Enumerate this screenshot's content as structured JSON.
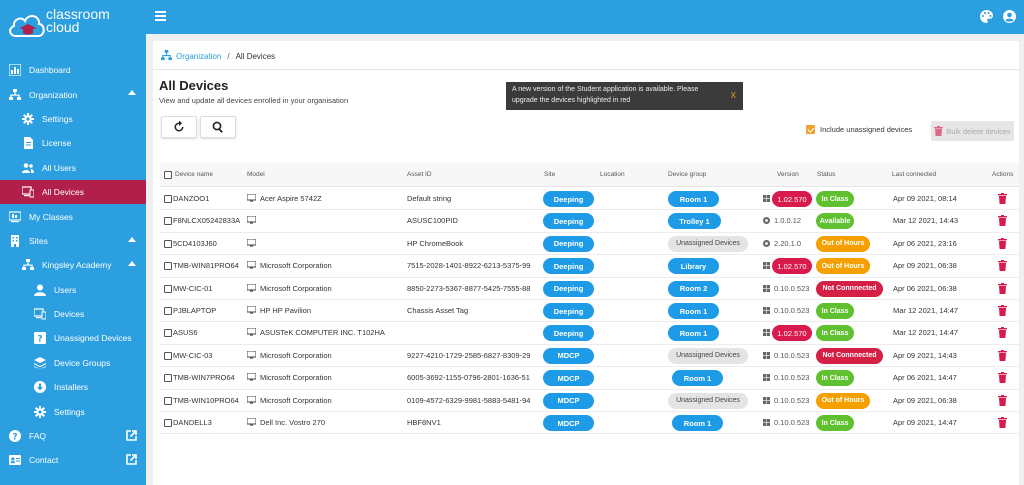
{
  "app": {
    "logo_line1": "classroom",
    "logo_line2": "cloud"
  },
  "nav": {
    "dashboard": "Dashboard",
    "organization": "Organization",
    "settings": "Settings",
    "license": "License",
    "all_users": "All Users",
    "all_devices": "All Devices",
    "my_classes": "My Classes",
    "sites": "Sites",
    "kingsley": "Kingsley Academy",
    "users": "Users",
    "devices": "Devices",
    "unassigned_devices": "Unassigned Devices",
    "device_groups": "Device Groups",
    "installers": "Installers",
    "site_settings": "Settings",
    "faq": "FAQ",
    "contact": "Contact"
  },
  "breadcrumb": {
    "root": "Organization",
    "sep": "/",
    "current": "All Devices"
  },
  "page": {
    "title": "All Devices",
    "subtitle": "View and update all devices enrolled in your organisation"
  },
  "toast": {
    "message": "A new version of the Student application is available. Please upgrade the devices highlighted in red",
    "close": "X"
  },
  "toolbar": {
    "include_unassigned": "Include unassigned devices",
    "bulk_delete": "Bulk delete devices"
  },
  "table": {
    "headers": {
      "device_name": "Device name",
      "model": "Model",
      "asset_id": "Asset ID",
      "site": "Site",
      "location": "Location",
      "device_group": "Device group",
      "version": "Version",
      "status": "Status",
      "last_connected": "Last connected",
      "actions": "Actions"
    },
    "rows": [
      {
        "name": "DANZOO1",
        "model": "Acer Aspire 5742Z",
        "asset": "Default string",
        "site": "Deeping",
        "group": "Room 1",
        "group_type": "room",
        "os": "windows",
        "version": "1.02.570",
        "outdated": true,
        "status": "In Class",
        "status_type": "inclass",
        "last": "Apr 09 2021, 08:14"
      },
      {
        "name": "F8NLCX05242833A",
        "model": "",
        "asset": "ASUSC100PID",
        "site": "Deeping",
        "group": "Trolley 1",
        "group_type": "trolley",
        "os": "chrome",
        "version": "1.0.0.12",
        "outdated": false,
        "status": "Available",
        "status_type": "available",
        "last": "Mar 12 2021, 14:43"
      },
      {
        "name": "5CD4103J60",
        "model": "",
        "asset": "HP ChromeBook",
        "site": "Deeping",
        "group": "Unassigned Devices",
        "group_type": "unassigned",
        "os": "chrome",
        "version": "2.20.1.0",
        "outdated": false,
        "status": "Out of Hours",
        "status_type": "out",
        "last": "Apr 06 2021, 23:16"
      },
      {
        "name": "TMB-WIN81PRO64",
        "model": "Microsoft Corporation",
        "asset": "7515-2028-1401-8922-6213-5375-99",
        "site": "Deeping",
        "group": "Library",
        "group_type": "room",
        "os": "windows",
        "version": "1.02.570",
        "outdated": true,
        "status": "Out of Hours",
        "status_type": "out",
        "last": "Apr 09 2021, 06:38"
      },
      {
        "name": "MW-CIC-01",
        "model": "Microsoft Corporation",
        "asset": "8850-2273-5367-8877-5425-7555-88",
        "site": "Deeping",
        "group": "Room 2",
        "group_type": "room",
        "os": "windows",
        "version": "0.10.0.523",
        "outdated": false,
        "status": "Not Connnected",
        "status_type": "notconn",
        "last": "Apr 06 2021, 06:38"
      },
      {
        "name": "PJBLAPTOP",
        "model": "HP HP Pavilion",
        "asset": "Chassis Asset Tag",
        "site": "Deeping",
        "group": "Room 1",
        "group_type": "room",
        "os": "windows",
        "version": "0.10.0.523",
        "outdated": false,
        "status": "In Class",
        "status_type": "inclass",
        "last": "Mar 12 2021, 14:47"
      },
      {
        "name": "ASUS6",
        "model": "ASUSTeK COMPUTER INC. T102HA",
        "asset": "",
        "site": "Deeping",
        "group": "Room 1",
        "group_type": "room",
        "os": "windows",
        "version": "1.02.570",
        "outdated": true,
        "status": "In Class",
        "status_type": "inclass",
        "last": "Mar 12 2021, 14:47"
      },
      {
        "name": "MW-CIC-03",
        "model": "Microsoft Corporation",
        "asset": "9227-4210-1729-2585-6827-8309-29",
        "site": "MDCP",
        "group": "Unassigned Devices",
        "group_type": "unassigned",
        "os": "windows",
        "version": "0.10.0.523",
        "outdated": false,
        "status": "Not Connnected",
        "status_type": "notconn",
        "last": "Apr 09 2021, 14:43"
      },
      {
        "name": "TMB-WIN7PRO64",
        "model": "Microsoft Corporation",
        "asset": "6005-3692-1155-0796-2801-1636-51",
        "site": "MDCP",
        "group": "Room 1",
        "group_type": "room",
        "os": "windows",
        "version": "0.10.0.523",
        "outdated": false,
        "status": "In Class",
        "status_type": "inclass",
        "last": "Apr 06 2021, 14:47"
      },
      {
        "name": "TMB-WIN10PRO64",
        "model": "Microsoft Corporation",
        "asset": "0109-4572-6329-9981-5883-5481-94",
        "site": "MDCP",
        "group": "Unassigned Devices",
        "group_type": "unassigned",
        "os": "windows",
        "version": "0.10.0.523",
        "outdated": false,
        "status": "Out of Hours",
        "status_type": "out",
        "last": "Apr 09 2021, 06:38"
      },
      {
        "name": "DANDELL3",
        "model": "Dell Inc. Vostro 270",
        "asset": "HBF8NV1",
        "site": "MDCP",
        "group": "Room 1",
        "group_type": "room",
        "os": "windows",
        "version": "0.10.0.523",
        "outdated": false,
        "status": "In Class",
        "status_type": "inclass",
        "last": "Apr 09 2021, 14:47"
      }
    ]
  },
  "colors": {
    "brand_blue": "#2b9fe0",
    "active_nav": "#b0204a",
    "outdated_red": "#d81b4c",
    "in_class_green": "#5fc12f",
    "out_of_hours_orange": "#f5a000"
  },
  "icons": {
    "monitor": "monitor-icon",
    "windows": "windows-icon",
    "chrome": "chrome-icon",
    "delete": "trash-icon"
  }
}
